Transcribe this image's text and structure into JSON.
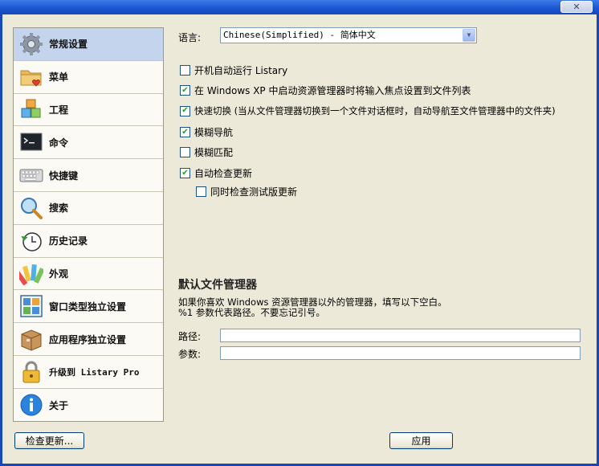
{
  "window": {
    "close_glyph": "✕"
  },
  "sidebar": {
    "items": [
      {
        "label": "常规设置",
        "icon": "gear-icon",
        "active": true
      },
      {
        "label": "菜单",
        "icon": "folder-heart-icon",
        "active": false
      },
      {
        "label": "工程",
        "icon": "cubes-icon",
        "active": false
      },
      {
        "label": "命令",
        "icon": "terminal-icon",
        "active": false
      },
      {
        "label": "快捷键",
        "icon": "keyboard-icon",
        "active": false
      },
      {
        "label": "搜索",
        "icon": "magnifier-icon",
        "active": false
      },
      {
        "label": "历史记录",
        "icon": "history-clock-icon",
        "active": false
      },
      {
        "label": "外观",
        "icon": "palette-icon",
        "active": false
      },
      {
        "label": "窗口类型独立设置",
        "icon": "window-grid-icon",
        "active": false
      },
      {
        "label": "应用程序独立设置",
        "icon": "package-box-icon",
        "active": false
      },
      {
        "label": "升级到 Listary Pro",
        "icon": "lock-icon",
        "active": false
      },
      {
        "label": "关于",
        "icon": "info-icon",
        "active": false
      }
    ]
  },
  "general": {
    "language_label": "语言:",
    "language_value": "Chinese(Simplified) - 简体中文",
    "options": [
      {
        "label": "开机自动运行 Listary",
        "checked": false
      },
      {
        "label": "在 Windows XP 中启动资源管理器时将输入焦点设置到文件列表",
        "checked": true
      },
      {
        "label": "快速切换 (当从文件管理器切换到一个文件对话框时，自动导航至文件管理器中的文件夹)",
        "checked": true
      },
      {
        "label": "模糊导航",
        "checked": true
      },
      {
        "label": "模糊匹配",
        "checked": false
      },
      {
        "label": "自动检查更新",
        "checked": true
      },
      {
        "label": "同时检查测试版更新",
        "checked": false
      }
    ],
    "default_fm": {
      "title": "默认文件管理器",
      "desc1": "如果你喜欢 Windows 资源管理器以外的管理器，填写以下空白。",
      "desc2": "%1 参数代表路径。不要忘记引号。",
      "path_label": "路径:",
      "path_value": "",
      "args_label": "参数:",
      "args_value": ""
    }
  },
  "footer": {
    "check_updates_label": "检查更新...",
    "apply_label": "应用"
  }
}
